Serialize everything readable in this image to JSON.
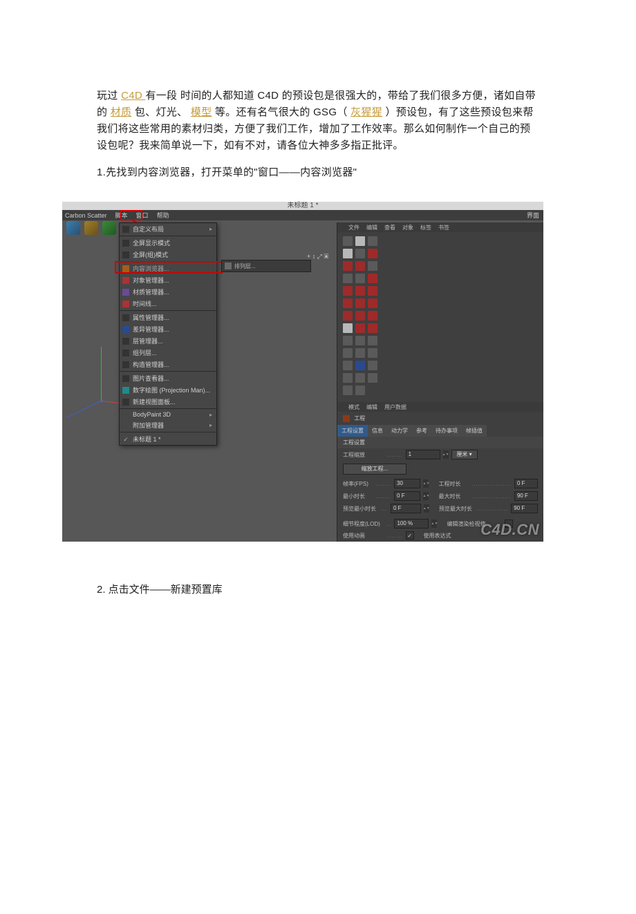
{
  "para1": {
    "t1": "玩过 ",
    "link_c4d": "C4D ",
    "t2": "有一段  时间的人都知道 C4D 的预设包是很强大的，带给了我们很多方便，诸如自带的",
    "link_mat": "材质",
    "t3": "包、灯光、",
    "link_model": "模型",
    "t4": "等。还有名气很大的 GSG（",
    "link_gsg": "灰猩猩",
    "t5": "）预设包，有了这些预设包来帮我们将这些常用的素材归类，方便了我们工作，增加了工作效率。那么如何制作一个自己的预设包呢？我来简单说一下，如有不对，请各位大神多多指正批评。"
  },
  "step1": "1.先找到内容浏览器，打开菜单的\"窗口——内容浏览器\"",
  "shot": {
    "title": "未标题 1 *",
    "menu": {
      "carbon": "Carbon Scatter",
      "script": "脚本",
      "window": "窗口",
      "help": "帮助",
      "right": "界面"
    },
    "dropdown": {
      "custom_layout": "自定义布局",
      "fullscreen_mode": "全屏显示模式",
      "fullscreen_area": "全屏(组)模式",
      "content_browser": "内容浏览器...",
      "object_manager": "对象管理器...",
      "material_manager": "材质管理器...",
      "timeline": "时间线...",
      "attr_manager": "属性管理器...",
      "xref_manager": "差异管理器...",
      "layer_manager": "层管理器...",
      "groups": "组列层...",
      "structure": "构造管理器...",
      "picture_viewer": "图片查看器...",
      "projection_man": "数字绘图 (Projection Man)...",
      "new_view": "新建视图面板...",
      "bodypaint": "BodyPaint 3D",
      "additional": "附加管理器",
      "untitled": "未标题 1 *"
    },
    "layerbar": "排列层...",
    "viewicons": "+ ↕ ⤢ ▣",
    "objmenu": {
      "file": "文件",
      "edit": "编辑",
      "view": "查看",
      "obj": "对象",
      "tag": "标签",
      "bm": "书签"
    },
    "attrmenu": {
      "mode": "模式",
      "edit": "编辑",
      "user": "用户数据"
    },
    "project": "工程",
    "tabs": {
      "settings": "工程设置",
      "info": "信息",
      "dyn": "动力学",
      "ref": "参考",
      "todo": "待办事项",
      "inter": "帧插值"
    },
    "section": "工程设置",
    "rows": {
      "scale_lbl": "工程缩放",
      "scale_val": "1",
      "scale_unit": "厘米",
      "scale_btn": "缩放工程...",
      "fps_lbl": "帧率(FPS)",
      "fps_val": "30",
      "dur_lbl": "工程时长",
      "dur_val": "0 F",
      "min_lbl": "最小时长",
      "min_val": "0 F",
      "max_lbl": "最大时长",
      "max_val": "90 F",
      "pmin_lbl": "预览最小时长",
      "pmin_val": "0 F",
      "pmax_lbl": "预览最大时长",
      "pmax_val": "90 F",
      "lod_lbl": "细节程度(LOD)",
      "lod_val": "100 %",
      "lod_r_lbl": "编辑渲染检视使",
      "anim_lbl": "使用动画",
      "expr_lbl": "使用表达式"
    },
    "watermark": "C4D.CN"
  },
  "step2": "2. 点击文件——新建预置库"
}
